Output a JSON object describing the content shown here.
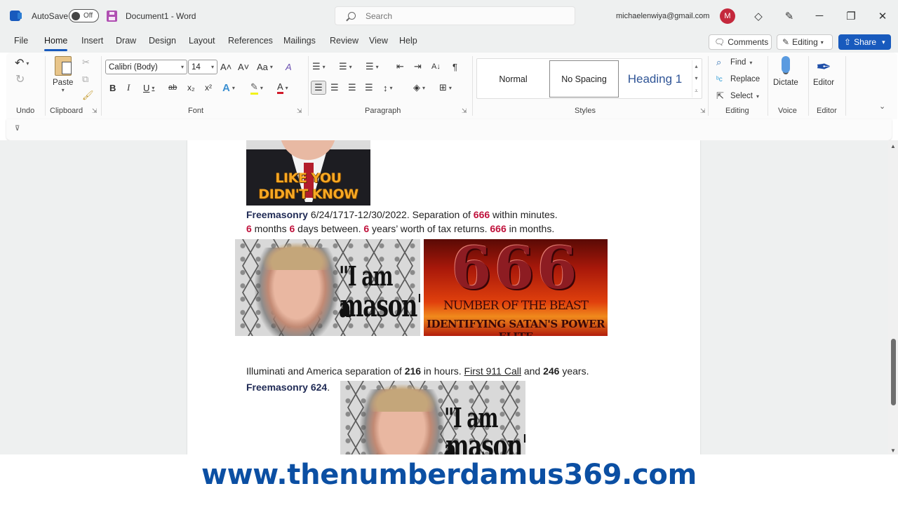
{
  "titlebar": {
    "app_icon": "word-logo-icon",
    "autosave_label": "AutoSave",
    "autosave_state": "Off",
    "doc_title": "Document1  -  Word",
    "search_placeholder": "Search",
    "account_email": "michaelenwiya@gmail.com",
    "avatar_initial": "M",
    "avatar_color": "#c4283c",
    "icons": [
      "diamond-icon",
      "pen-icon",
      "minimize-icon",
      "restore-icon",
      "close-icon"
    ],
    "window_glyphs": {
      "diamond": "◇",
      "pen": "✎",
      "minimize": "─",
      "restore": "❐",
      "close": "✕"
    }
  },
  "menu": {
    "tabs": [
      "File",
      "Home",
      "Insert",
      "Draw",
      "Design",
      "Layout",
      "References",
      "Mailings",
      "Review",
      "View",
      "Help"
    ],
    "active_tab": "Home",
    "comments_label": "Comments",
    "editing_label": "Editing",
    "share_label": "Share",
    "accent_color": "#185abd"
  },
  "ribbon": {
    "groups": {
      "undo": "Undo",
      "clipboard": "Clipboard",
      "font": "Font",
      "paragraph": "Paragraph",
      "styles": "Styles",
      "editing": "Editing",
      "voice": "Voice",
      "editor": "Editor"
    },
    "paste_label": "Paste",
    "font_name": "Calibri (Body)",
    "font_size": "14",
    "font_buttons": {
      "grow": "A˄",
      "shrink": "A˅",
      "case": "Aa",
      "bold": "B",
      "italic": "I",
      "underline": "U",
      "strike": "ab",
      "subscript": "x₂",
      "superscript": "x²",
      "effects": "A",
      "highlight": "✎",
      "color": "A"
    },
    "paragraph_buttons": {
      "bullets": "☰",
      "numbering": "☰",
      "multilevel": "☰",
      "decrease_indent": "⇤",
      "increase_indent": "⇥",
      "sort": "A↓",
      "pilcrow": "¶",
      "align_left": "☰",
      "center": "☰",
      "align_right": "☰",
      "justify": "☰",
      "line_spacing": "↕",
      "shading": "◈",
      "borders": "⊞"
    },
    "styles": [
      "Normal",
      "No Spacing",
      "Heading 1"
    ],
    "selected_style": "No Spacing",
    "editing_items": [
      {
        "label": "Find",
        "icon": "⌕"
      },
      {
        "label": "Replace",
        "icon": "ᵇc"
      },
      {
        "label": "Select",
        "icon": "⇱"
      }
    ],
    "dictate_label": "Dictate",
    "editor_label": "Editor"
  },
  "document": {
    "image1_caption": [
      "LIKE YOU",
      "DIDN'T KNOW"
    ],
    "para1": {
      "l1": {
        "a": "Freemasonry",
        "b": " 6/24/1717-12/30/2022. Separation of ",
        "c": "666",
        "d": " within minutes."
      },
      "l2": {
        "a": "6",
        "b": " months ",
        "c": "6",
        "d": " days between. ",
        "e": "6",
        "f": " years’ worth of tax returns. ",
        "g": "666",
        "h": " in months."
      }
    },
    "image_mason_text": [
      "\"I am a",
      "mason\""
    ],
    "image_666": {
      "number": "666",
      "line1": "NUMBER OF THE BEAST",
      "line2": "IDENTIFYING SATAN'S POWER ELITE"
    },
    "para2": {
      "l1": {
        "a": "Illuminati and America separation of ",
        "b": "216",
        "c": " in hours. ",
        "d": "First 911 Call",
        "e": " and ",
        "f": "246",
        "g": " years."
      },
      "l2": {
        "a": "Freemasonry 624",
        "b": "."
      }
    },
    "highlight_color": "#c0123c",
    "navy_color": "#1f2a55"
  },
  "banner": {
    "url": "www.thenumberdamus369.com",
    "color": "#0b4fa3"
  }
}
